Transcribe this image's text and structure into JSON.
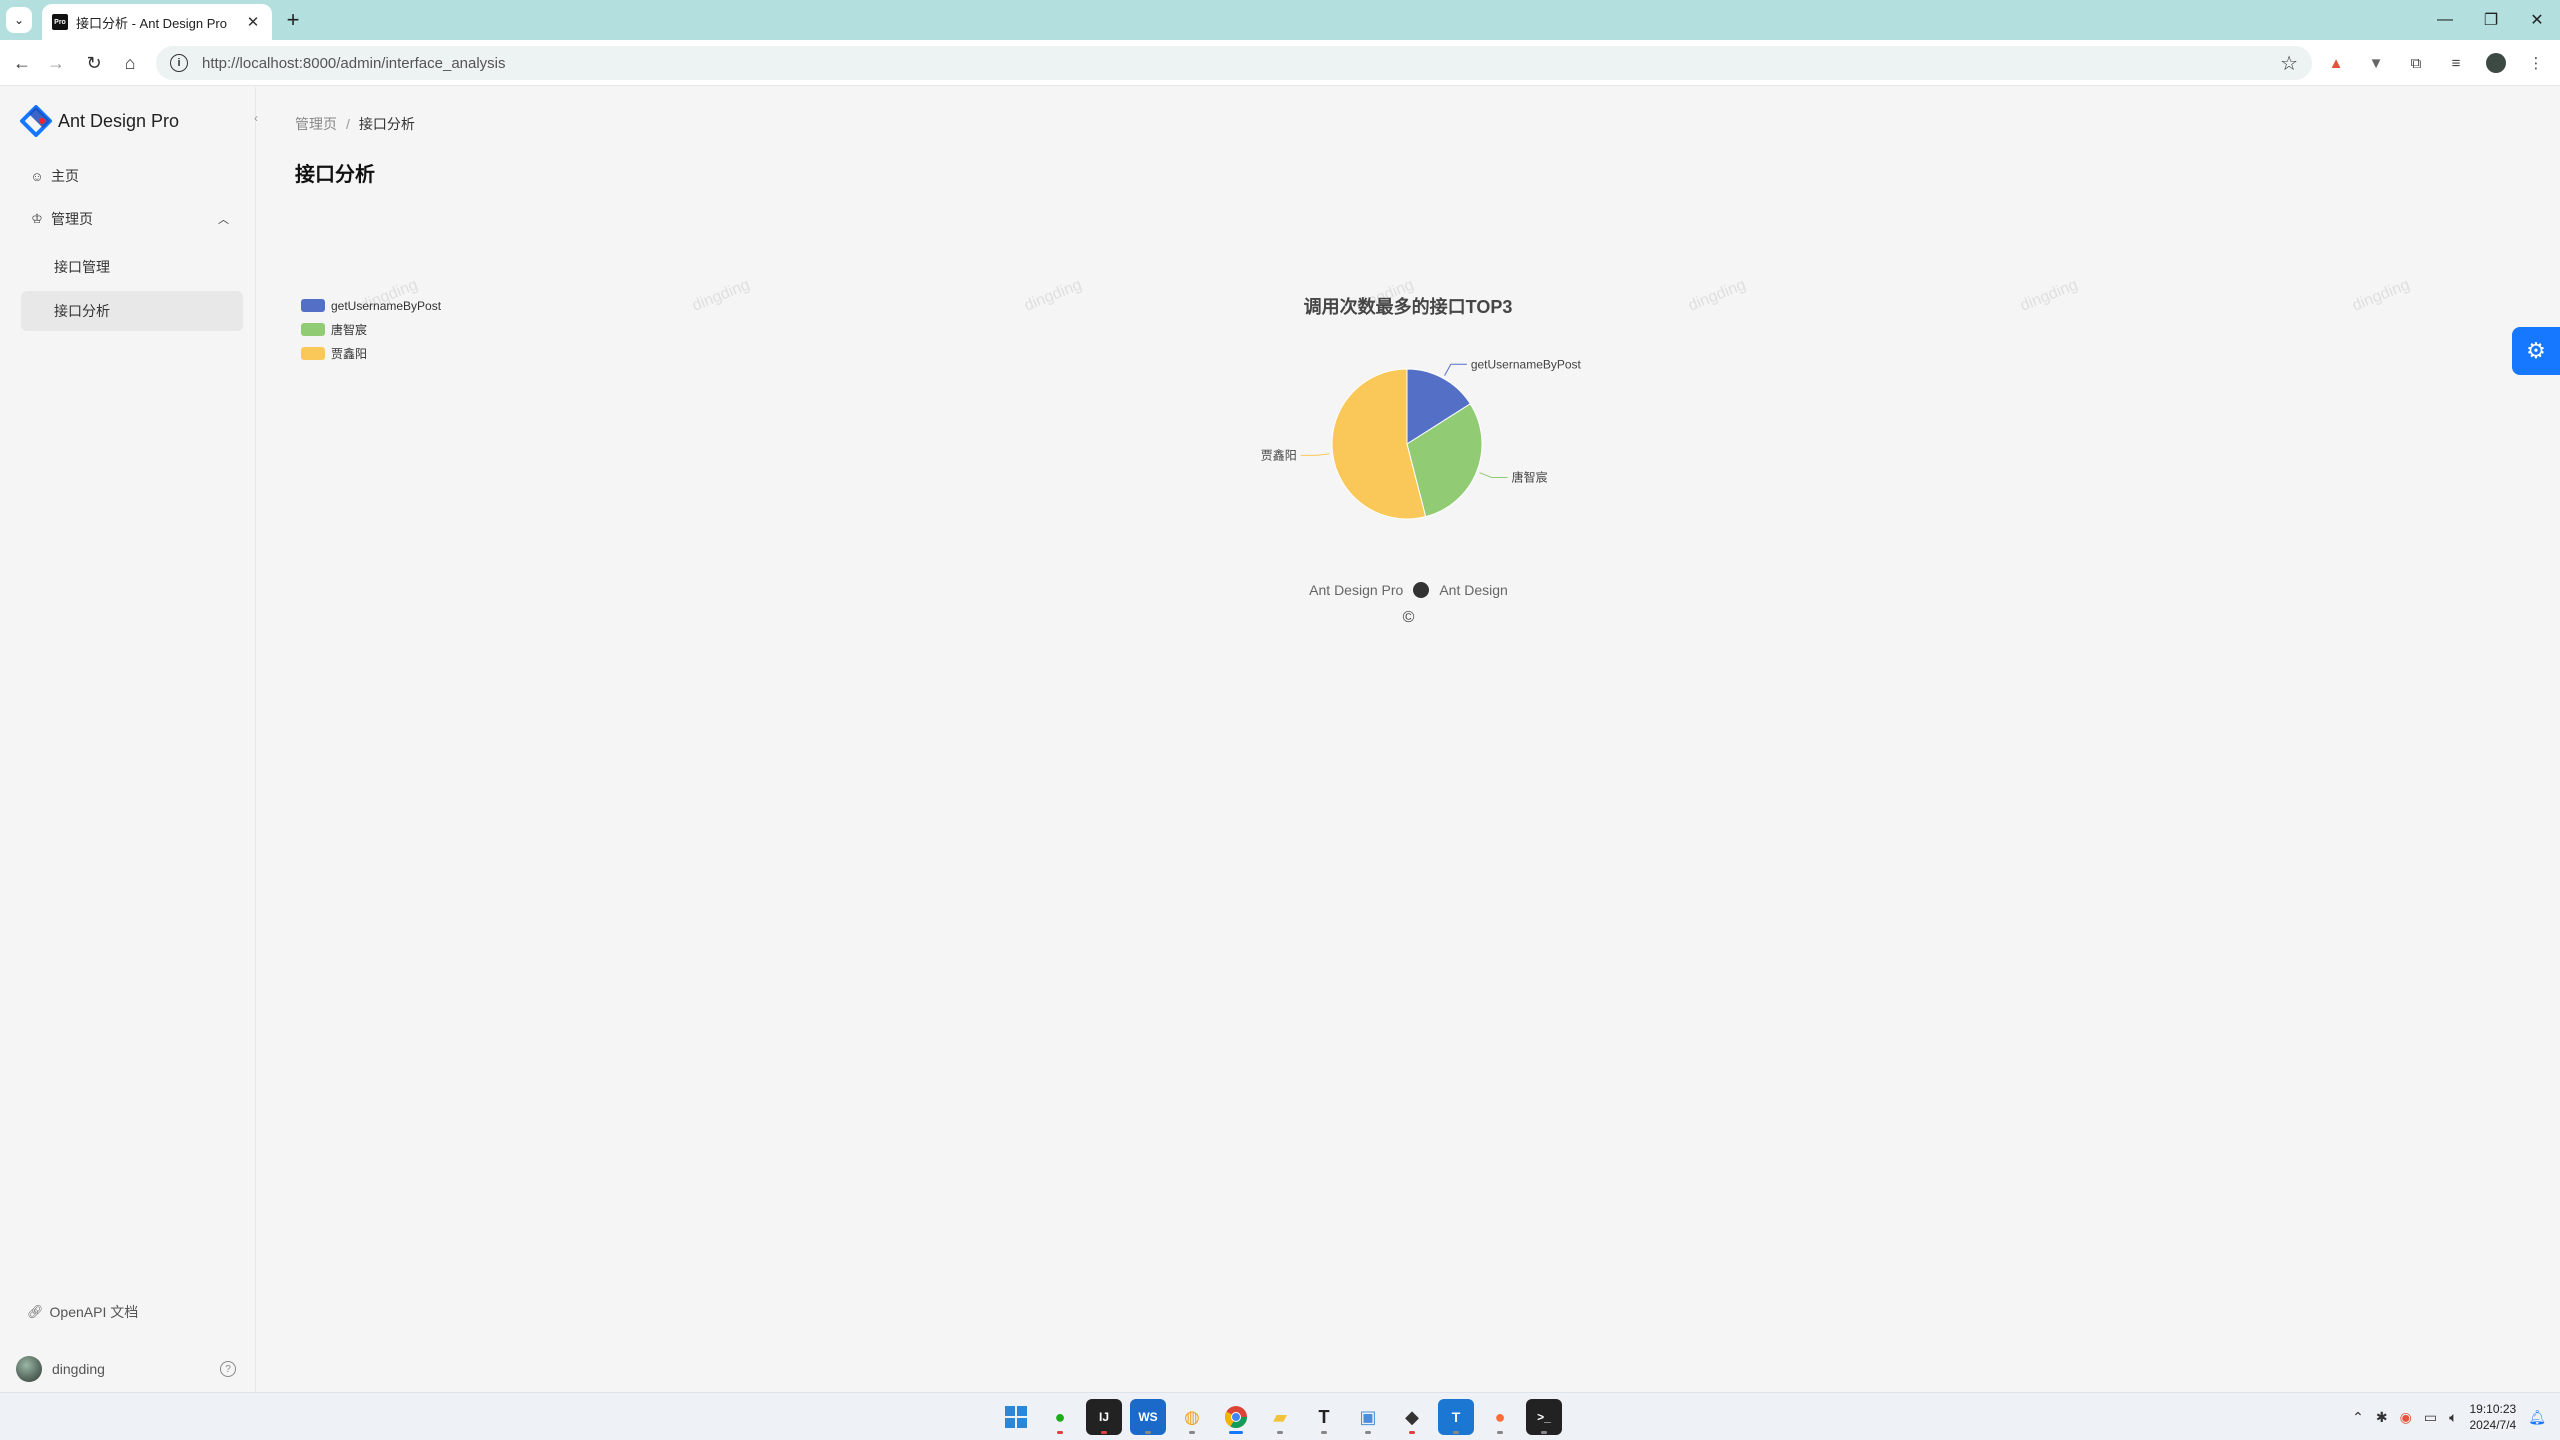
{
  "browser": {
    "tab_title": "接口分析 - Ant Design Pro",
    "tab_favicon": "Pro",
    "url": "http://localhost:8000/admin/interface_analysis"
  },
  "app": {
    "logo_text": "Ant Design Pro",
    "menu": {
      "home": "主页",
      "admin": "管理页",
      "interface_manage": "接口管理",
      "interface_analysis": "接口分析"
    },
    "openapi_link": "OpenAPI 文档",
    "user_name": "dingding",
    "breadcrumb": [
      "管理页",
      "接口分析"
    ],
    "breadcrumb_sep": "/",
    "page_title": "接口分析",
    "watermark_text": "dingding",
    "footer": {
      "left": "Ant Design Pro",
      "right": "Ant Design",
      "copyright": "©"
    }
  },
  "chart_data": {
    "type": "pie",
    "title": "调用次数最多的接口TOP3",
    "categories": [
      "getUsernameByPost",
      "唐智宸",
      "贾鑫阳"
    ],
    "values": [
      16,
      30,
      54
    ],
    "colors": [
      "#5470c6",
      "#91cc75",
      "#fac858"
    ],
    "legend_position": "top-left"
  },
  "taskbar": {
    "time": "19:10:23",
    "date": "2024/7/4"
  }
}
